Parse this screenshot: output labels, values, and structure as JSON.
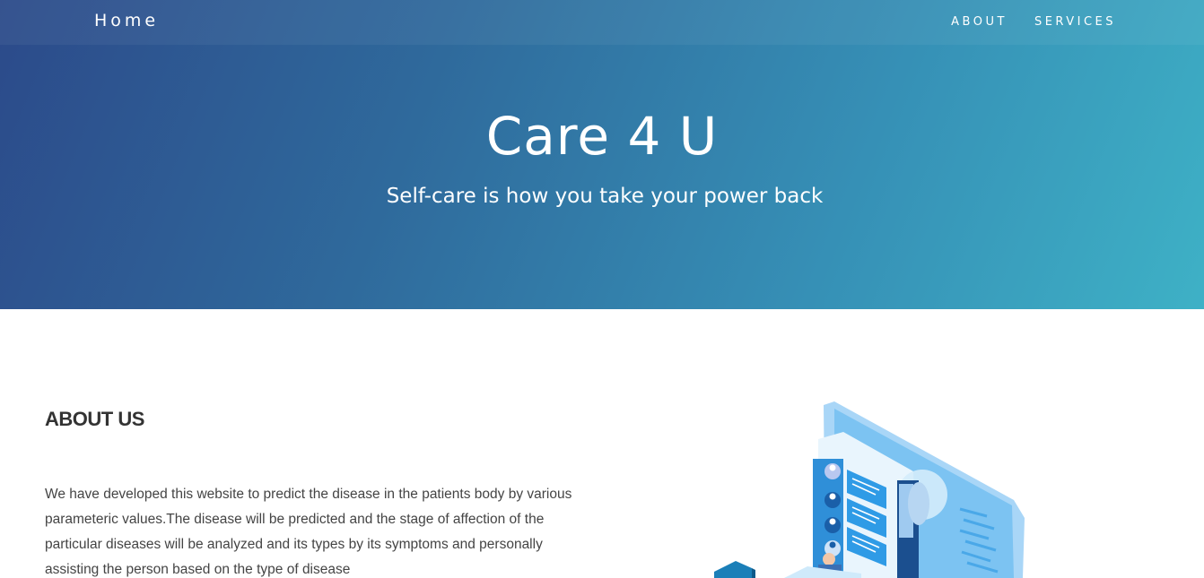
{
  "navbar": {
    "brand": "Home",
    "links": [
      {
        "label": "ABOUT"
      },
      {
        "label": "SERVICES"
      }
    ]
  },
  "hero": {
    "title": "Care 4 U",
    "subtitle": "Self-care is how you take your power back"
  },
  "about": {
    "heading": "ABOUT US",
    "body": "We have developed this website to predict the disease in the patients body by various parameteric values.The disease will be predicted and the stage of affection of the particular diseases will be analyzed and its types by its symptoms and personally assisting the person based on the type of disease"
  },
  "colors": {
    "hero_gradient_start": "#2c4a8a",
    "hero_gradient_end": "#3eb1c6",
    "heading_text": "#333333",
    "body_text": "#444444"
  },
  "illustration": {
    "icon": "doctor-consultation-illustration"
  }
}
